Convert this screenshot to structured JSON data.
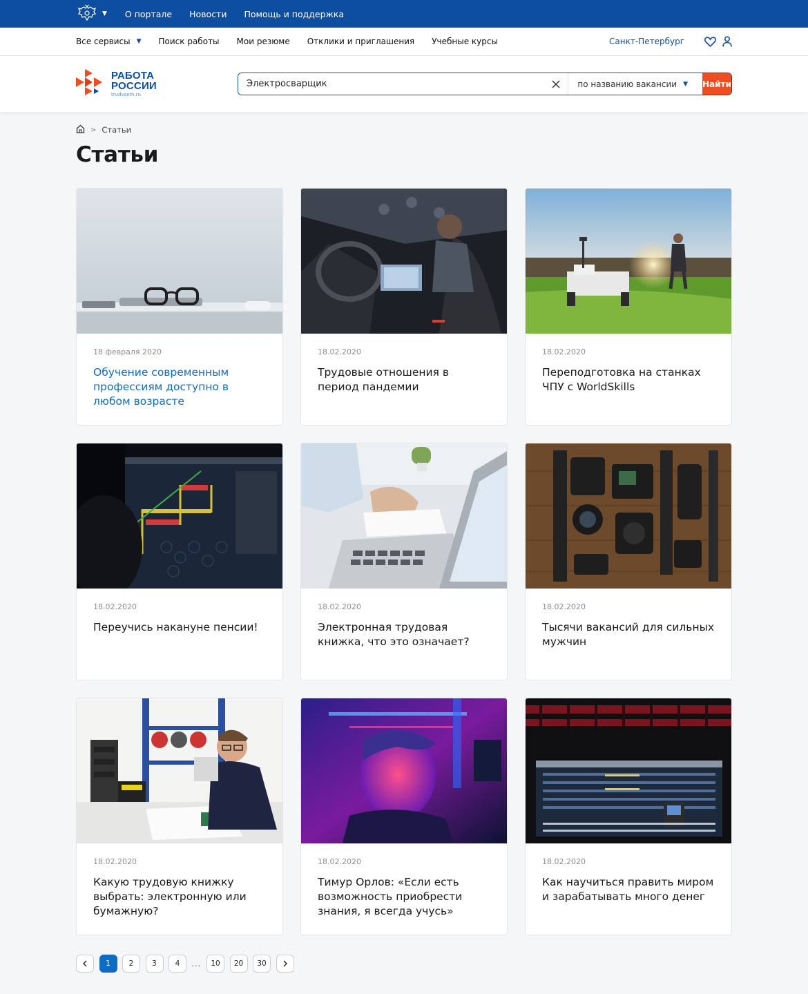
{
  "gov_bar": {
    "links": [
      "О портале",
      "Новости",
      "Помощь и поддержка"
    ],
    "emblem_icon": "russia-emblem-icon"
  },
  "service_nav": {
    "all_services": "Все сервисы",
    "items": [
      "Поиск работы",
      "Мои резюме",
      "Отклики и приглашения",
      "Учебные курсы"
    ],
    "city": "Санкт-Петербург"
  },
  "logo": {
    "line1": "РАБОТА",
    "line2": "РОССИИ",
    "url": "trudvsem.ru"
  },
  "search": {
    "value": "Электросварщик",
    "mode": "по названию вакансии",
    "button": "Найти"
  },
  "breadcrumb": {
    "current": "Статьи"
  },
  "page_title": "Статьи",
  "articles": [
    {
      "date": "18 февраля 2020",
      "title": "Обучение современным профессиям доступно в любом возрасте",
      "image": "desk-glasses-laptop"
    },
    {
      "date": "18.02.2020",
      "title": "Трудовые отношения в период пандемии",
      "image": "woman-laptop-car"
    },
    {
      "date": "18.02.2020",
      "title": "Переподготовка на станках ЧПУ с WorldSkills",
      "image": "robot-field-sunset"
    },
    {
      "date": "18.02.2020",
      "title": "Переучись накануне пенсии!",
      "image": "cad-drawing-monitor"
    },
    {
      "date": "18.02.2020",
      "title": "Электронная трудовая книжка, что это означает?",
      "image": "hands-laptop-notebook"
    },
    {
      "date": "18.02.2020",
      "title": "Тысячи вакансий для сильных мужчин",
      "image": "camera-gear-flatlay"
    },
    {
      "date": "18.02.2020",
      "title": "Какую трудовую книжку выбрать: электронную или бумажную?",
      "image": "man-workshop-drawings"
    },
    {
      "date": "18.02.2020",
      "title": "Тимур Орлов: «Если есть возможность приобрести знания, я всегда учусь»",
      "image": "neon-lit-face"
    },
    {
      "date": "18.02.2020",
      "title": "Как научиться править миром и зарабатывать много денег",
      "image": "mixing-console-theater"
    }
  ],
  "pagination": {
    "pages": [
      "1",
      "2",
      "3",
      "4"
    ],
    "ellipsis": "...",
    "far_pages": [
      "10",
      "20",
      "30"
    ],
    "current": "1"
  },
  "colors": {
    "brand_blue": "#0d4ea0",
    "link_blue": "#0d6cc4",
    "accent_orange": "#ee4e22",
    "page_bg": "#f5f6f8"
  }
}
